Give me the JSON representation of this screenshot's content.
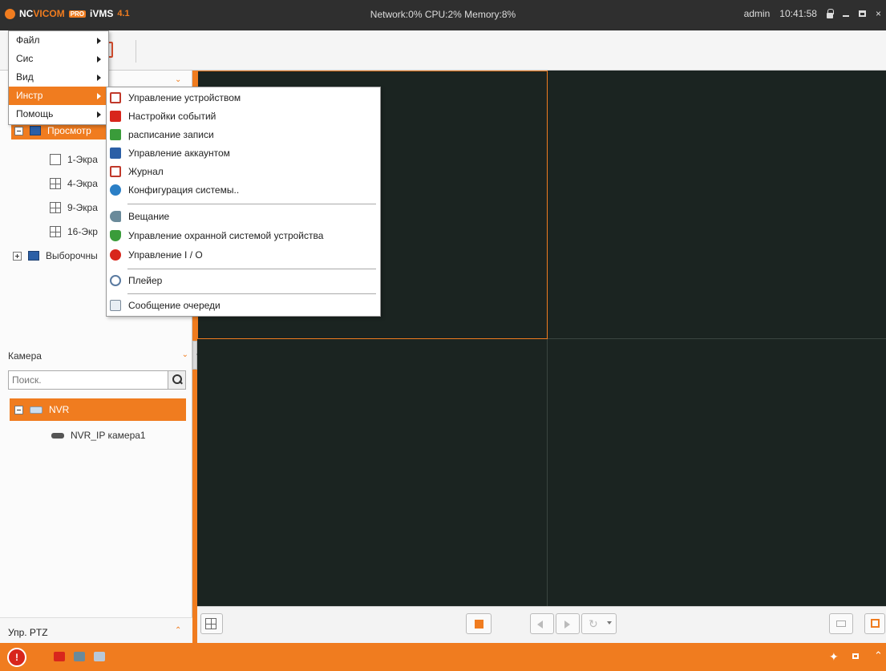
{
  "titlebar": {
    "brand_a": "NC",
    "brand_b": "VI",
    "brand_c": "COM",
    "brand_pro": "PRO",
    "product": "iVMS",
    "version": "4.1",
    "sysinfo": "Network:0% CPU:2% Memory:8%",
    "user": "admin",
    "time": "10:41:58"
  },
  "main_menu": [
    {
      "label": "Файл"
    },
    {
      "label": "Сис"
    },
    {
      "label": "Вид"
    },
    {
      "label": "Инстр",
      "active": true
    },
    {
      "label": "Помощь"
    }
  ],
  "tools_menu": [
    {
      "label": "Управление устройством",
      "icon": "device-management-icon",
      "color": "#c0392b"
    },
    {
      "label": "Настройки событий",
      "icon": "event-settings-icon",
      "color": "#d8261c"
    },
    {
      "label": "расписание записи",
      "icon": "record-schedule-icon",
      "color": "#3a9c3a"
    },
    {
      "label": "Управление аккаунтом",
      "icon": "account-management-icon",
      "color": "#2b5fa6"
    },
    {
      "label": "Журнал",
      "icon": "log-icon",
      "color": "#c0392b"
    },
    {
      "label": "Конфигурация системы..",
      "icon": "system-config-icon",
      "color": "#2b7fc6"
    },
    {
      "label": "Вещание",
      "icon": "broadcast-icon",
      "color": "#6a8a9a"
    },
    {
      "label": "Управление охранной системой устройства",
      "icon": "security-control-icon",
      "color": "#3a9c3a"
    },
    {
      "label": "Управление I / O",
      "icon": "io-management-icon",
      "color": "#d8261c"
    },
    {
      "label": "Плейер",
      "icon": "player-icon",
      "color": "#5a7aa0"
    },
    {
      "label": "Сообщение очереди",
      "icon": "message-queue-icon",
      "color": "#7a8a9a"
    }
  ],
  "view_tree": {
    "root_label": "Просмотр",
    "items": [
      "1-Экра",
      "4-Экра",
      "9-Экра",
      "16-Экр"
    ],
    "custom_label": "Выборочны"
  },
  "camera_section": {
    "title": "Камера",
    "search_placeholder": "Поиск.",
    "nvr_label": "NVR",
    "camera_label": "NVR_IP камера1"
  },
  "ptz": {
    "title": "Упр. PTZ"
  },
  "colors": {
    "accent": "#f07c1f",
    "titlebar": "#2f2f2f",
    "video_bg": "#1b2421"
  }
}
